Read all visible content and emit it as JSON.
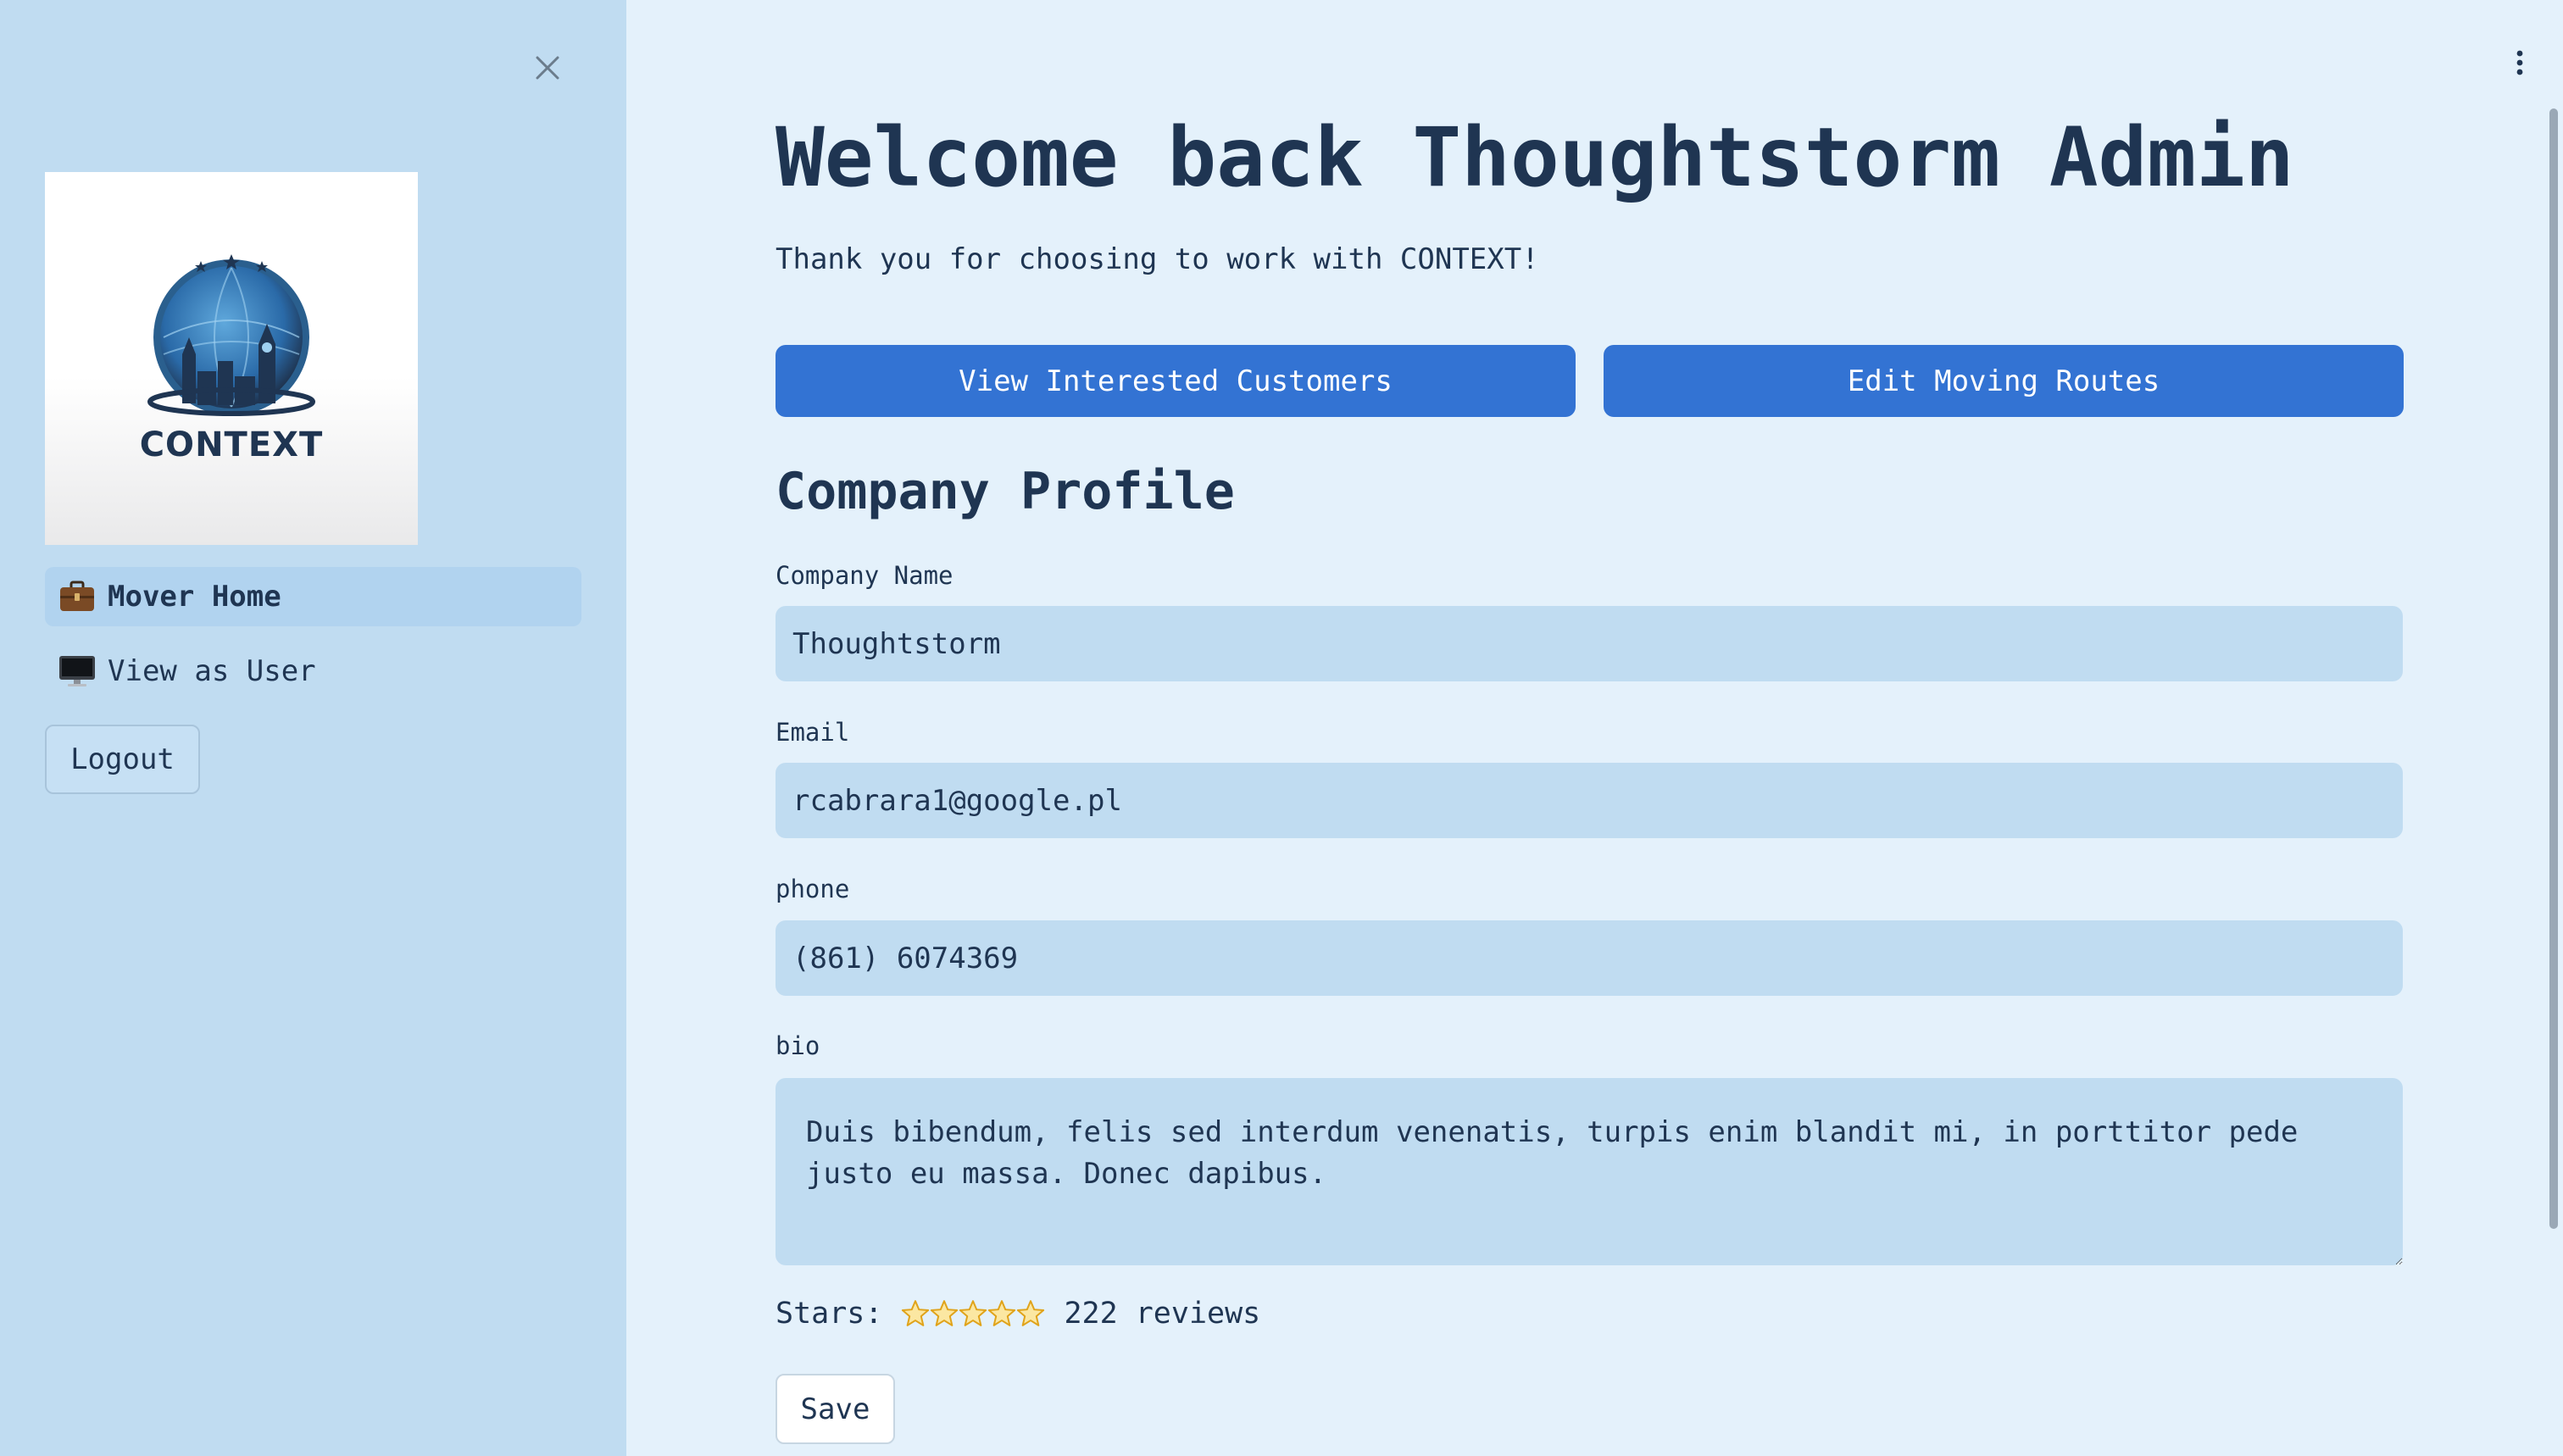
{
  "sidebar": {
    "logo_text": "CONTEXT",
    "items": [
      {
        "label": "Mover Home",
        "icon": "briefcase-icon",
        "active": true
      },
      {
        "label": "View as User",
        "icon": "monitor-icon",
        "active": false
      }
    ],
    "logout_label": "Logout"
  },
  "main": {
    "welcome": "Welcome back Thoughtstorm Admin",
    "subtitle": "Thank you for choosing to work with CONTEXT!",
    "buttons": {
      "customers": "View Interested Customers",
      "routes": "Edit Moving Routes"
    },
    "profile": {
      "title": "Company Profile",
      "company_name_label": "Company Name",
      "company_name_value": "Thoughtstorm",
      "email_label": "Email",
      "email_value": "rcabrara1@google.pl",
      "phone_label": "phone",
      "phone_value": "(861) 6074369",
      "bio_label": "bio",
      "bio_value": "Duis bibendum, felis sed interdum venenatis, turpis enim blandit mi, in porttitor pede justo eu massa. Donec dapibus.",
      "stars_label": "Stars:",
      "stars_count": 5,
      "reviews_text": "222 reviews",
      "save_label": "Save"
    }
  },
  "colors": {
    "sidebar_bg": "#c0dcf1",
    "main_bg": "#e4f1fb",
    "primary": "#3373d3",
    "text": "#1f3552"
  }
}
